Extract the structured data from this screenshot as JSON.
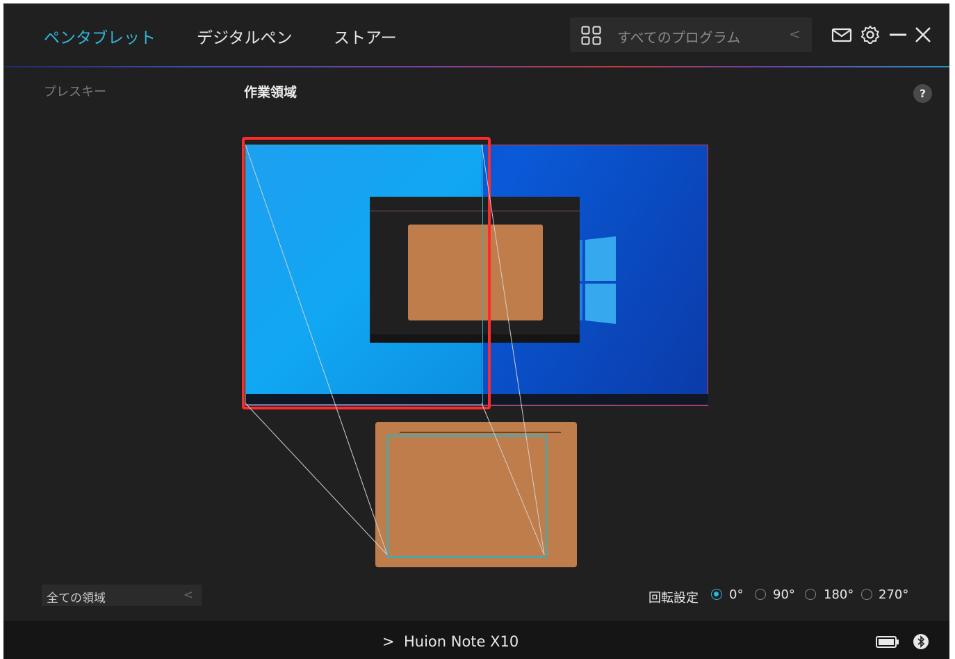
{
  "nav": {
    "tabs": [
      {
        "label": "ペンタブレット",
        "active": true
      },
      {
        "label": "デジタルペン",
        "active": false
      },
      {
        "label": "ストアー",
        "active": false
      }
    ]
  },
  "program_selector": {
    "icon": "grid-icon",
    "label": "すべてのプログラム",
    "arrow_icon": "chevron-left-icon"
  },
  "header_icons": [
    "mail-icon",
    "gear-icon",
    "minimize-icon",
    "close-icon"
  ],
  "sidebar": {
    "item": "プレスキー"
  },
  "section": {
    "title": "作業領域",
    "help": "?"
  },
  "work_area": {
    "area_select": {
      "value": "全ての領域",
      "arrow": "<"
    }
  },
  "rotation": {
    "label": "回転設定",
    "options": [
      "0°",
      "90°",
      "180°",
      "270°"
    ],
    "selected": "0°"
  },
  "footer": {
    "device_name": "Huion Note X10",
    "chevron": ">",
    "icons": [
      "battery-icon",
      "bluetooth-icon"
    ]
  },
  "colors": {
    "accent": "#2fb6d8",
    "selection": "#ff2a2a",
    "tablet": "#c07d4c",
    "background": "#202020"
  }
}
